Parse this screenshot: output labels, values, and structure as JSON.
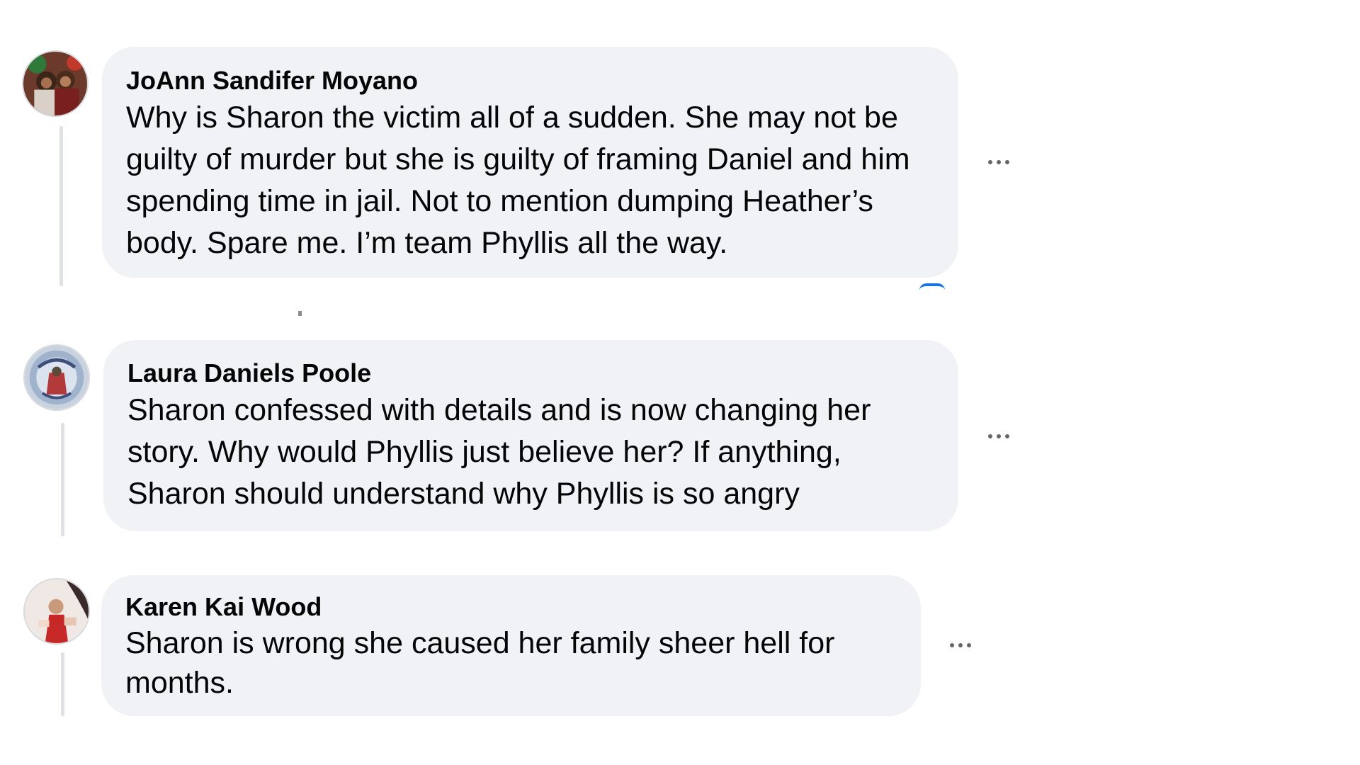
{
  "comments": [
    {
      "author": "JoAnn Sandifer Moyano",
      "text": "Why is Sharon the victim all of a sudden. She may not be guilty of murder but she is guilty of framing Daniel and him spending time in jail. Not to mention dumping Heather’s body. Spare me. I’m team Phyllis all the way.",
      "avatar_icon": "profile-photo-icon"
    },
    {
      "author": "Laura Daniels Poole",
      "text": "Sharon confessed with details and is now changing her story. Why would Phyllis just believe her? If anything, Sharon should understand why Phyllis is so angry",
      "avatar_icon": "profile-photo-icon"
    },
    {
      "author": "Karen Kai Wood",
      "text": "Sharon is wrong she caused her family sheer hell for months.",
      "avatar_icon": "profile-photo-icon"
    }
  ],
  "colors": {
    "bubble": "#f0f2f5",
    "text": "#050505",
    "thread_line": "#dfe1e5",
    "more_dots": "#65676b",
    "accent": "#1b74e4"
  },
  "more_icon": "more-horizontal-icon"
}
